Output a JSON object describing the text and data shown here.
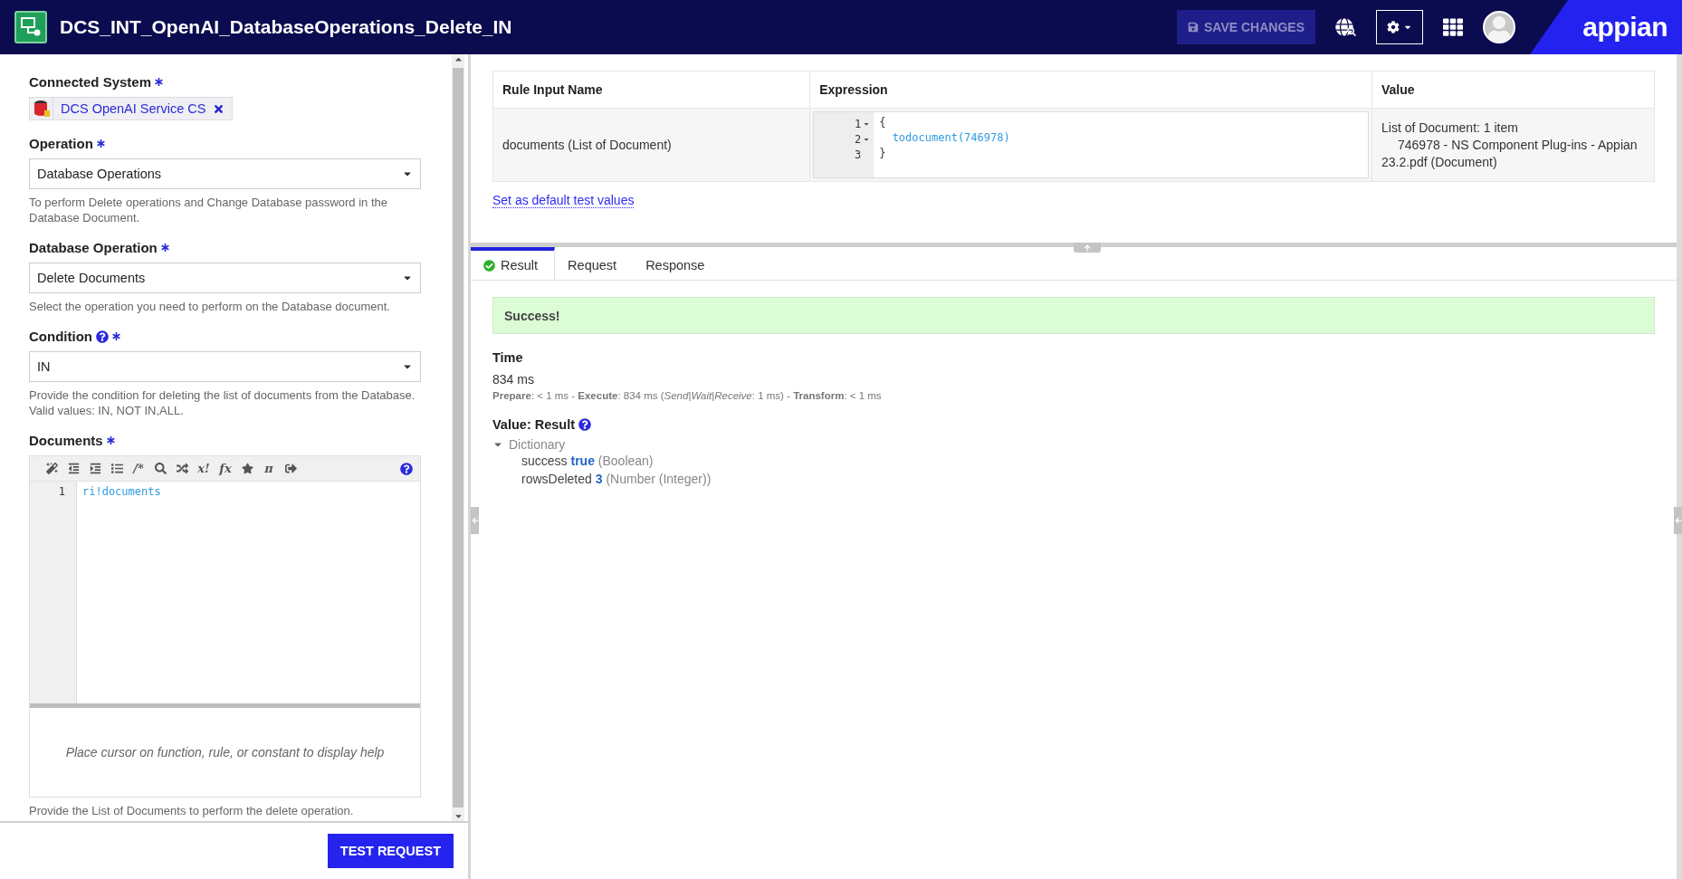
{
  "header": {
    "title": "DCS_INT_OpenAI_DatabaseOperations_Delete_IN",
    "save_button": {
      "label": "SAVE CHANGES",
      "disabled": true
    },
    "logo": "appian"
  },
  "form": {
    "fields": [
      {
        "kind": "picker",
        "label": "Connected System",
        "required": true,
        "value": "DCS OpenAI Service CS"
      },
      {
        "kind": "dropdown",
        "label": "Operation",
        "required": true,
        "value": "Database Operations",
        "help_text": "To perform Delete operations and Change Database password in the Database Document."
      },
      {
        "kind": "dropdown",
        "label": "Database Operation",
        "required": true,
        "value": "Delete Documents",
        "help_text": "Select the operation you need to perform on the Database document."
      },
      {
        "kind": "dropdown",
        "label": "Condition",
        "required": true,
        "tooltip": true,
        "value": "IN",
        "help_text": "Provide the condition for deleting the list of documents from the Database. Valid values: IN, NOT IN,ALL."
      },
      {
        "kind": "editor",
        "label": "Documents",
        "required": true,
        "toolbar": [
          {
            "kind": "wand"
          },
          {
            "kind": "outdent"
          },
          {
            "kind": "indent"
          },
          {
            "kind": "list"
          },
          {
            "kind": "glyph",
            "text": "/*"
          },
          {
            "kind": "search"
          },
          {
            "kind": "shuffle"
          },
          {
            "kind": "glyph",
            "text": "x!"
          },
          {
            "kind": "glyph",
            "text": "fx"
          },
          {
            "kind": "star"
          },
          {
            "kind": "glyph",
            "text": "π"
          },
          {
            "kind": "exit"
          }
        ],
        "lines": [
          {
            "number": "1",
            "code": "ri!documents"
          }
        ],
        "help_panel": "Place cursor on function, rule, or constant to display help",
        "help_text": "Provide the List of Documents to perform the delete operation."
      }
    ],
    "test_button": "TEST REQUEST"
  },
  "rule_inputs": {
    "columns": [
      "Rule Input Name",
      "Expression",
      "Value"
    ],
    "rows": [
      {
        "name": "documents (List of Document)",
        "expression": [
          {
            "number": "1",
            "foldable": true,
            "kind": "brace",
            "code": "{"
          },
          {
            "number": "2",
            "foldable": true,
            "kind": "call",
            "code": "  todocument(746978)"
          },
          {
            "number": "3",
            "foldable": false,
            "kind": "brace",
            "code": "}"
          }
        ],
        "value_lines": [
          "List of Document: 1 item",
          "746978 - NS Component Plug-ins - Appian 23.2.pdf (Document)"
        ]
      }
    ],
    "default_link": "Set as default test values"
  },
  "result": {
    "tabs": [
      {
        "label": "Result",
        "selected": true,
        "succeeded": true
      },
      {
        "label": "Request",
        "selected": false
      },
      {
        "label": "Response",
        "selected": false
      }
    ],
    "banner": "Success!",
    "time_label": "Time",
    "time": "834 ms",
    "breakdown": "**Prepare**: < 1 ms - **Execute**: 834 ms (*Send*|*Wait*|*Receive*: 1 ms) - **Transform**: < 1 ms",
    "value_label": "Value: Result",
    "value_tooltip": true,
    "tree": {
      "label": "Dictionary",
      "expanded": true,
      "children": [
        {
          "name": "success",
          "value": "true",
          "type": "(Boolean)"
        },
        {
          "name": "rowsDeleted",
          "value": "3",
          "type": "(Number (Integer))"
        }
      ]
    }
  }
}
